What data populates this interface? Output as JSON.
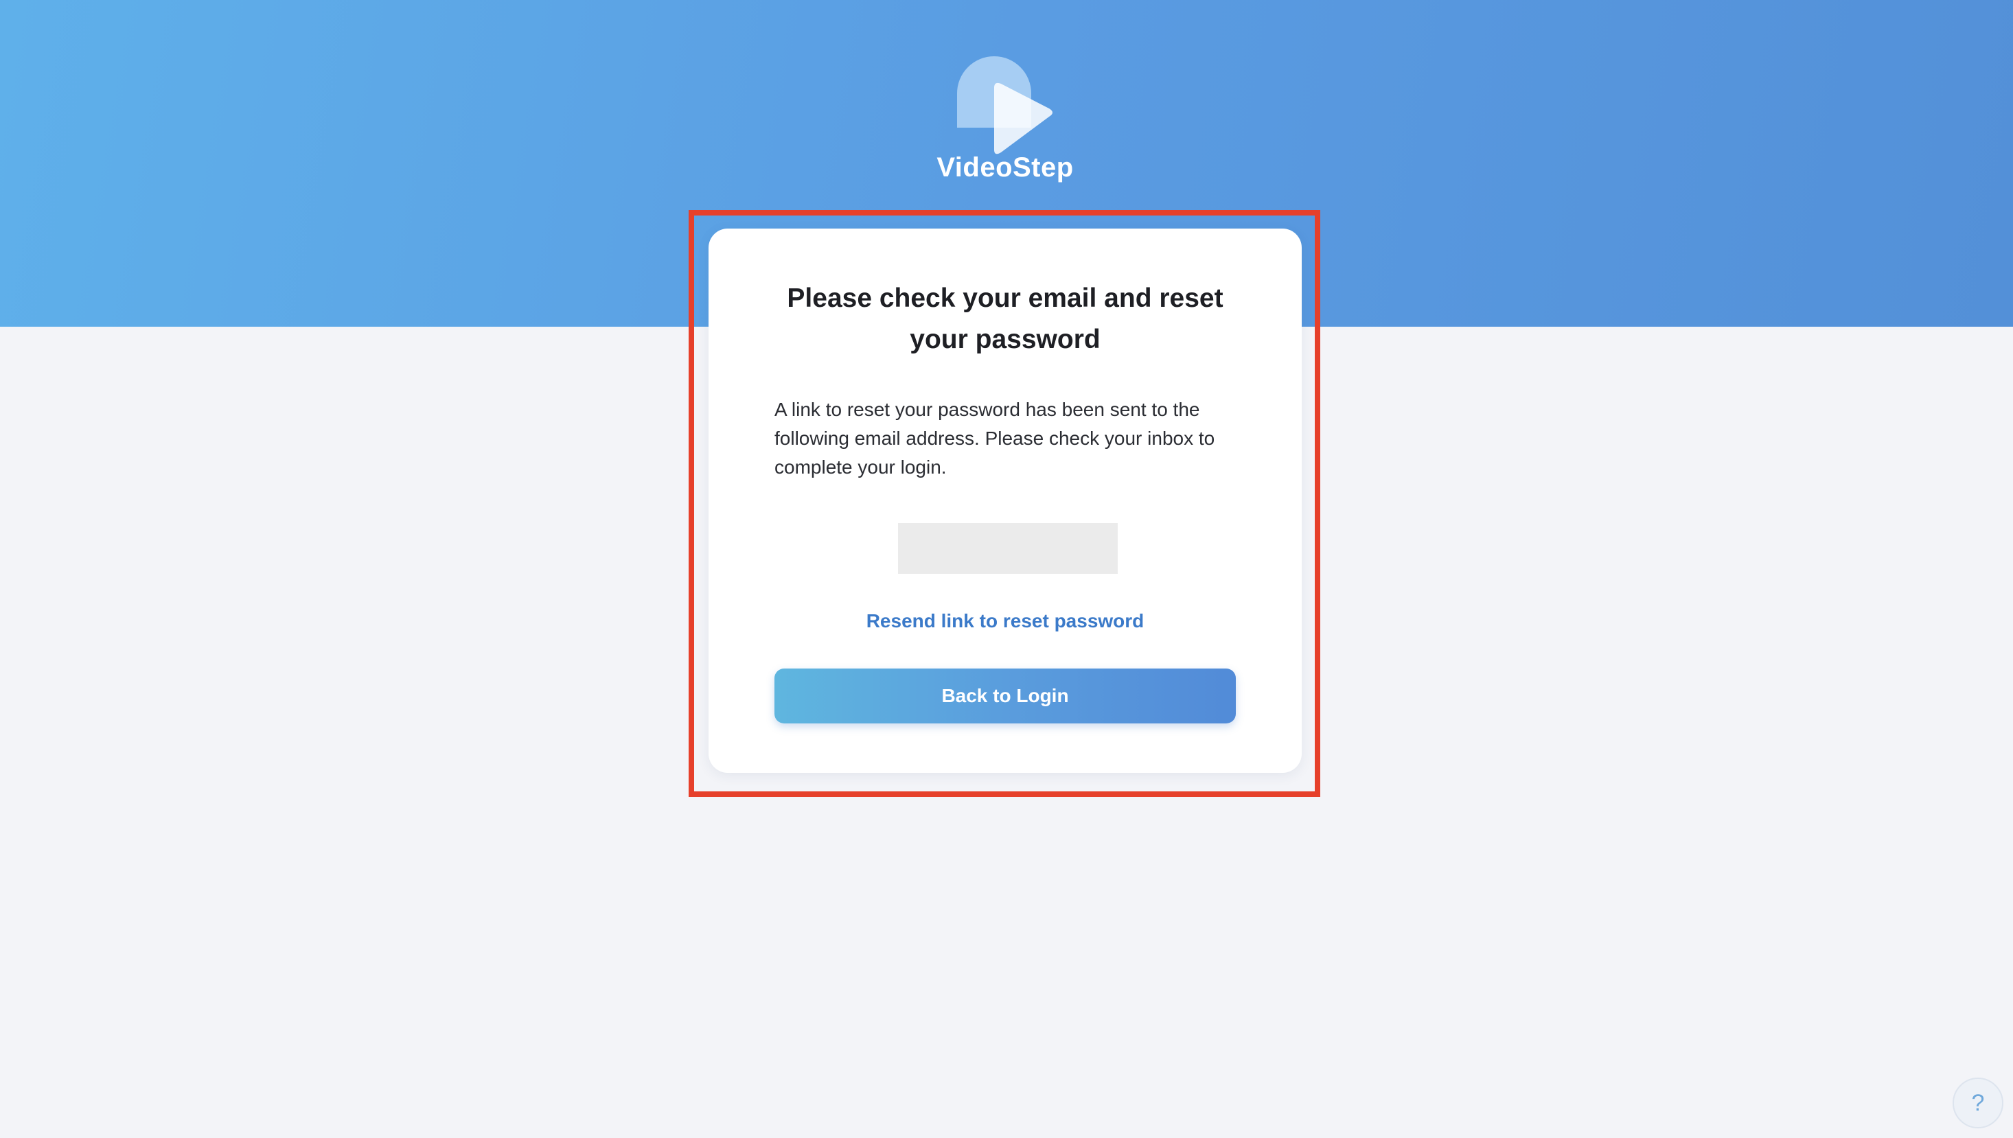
{
  "app": {
    "brand_name": "VideoStep",
    "logo_icon": "videostep-play-logo-icon"
  },
  "card": {
    "title": "Please check your email and reset your password",
    "body": "A link to reset your password has been sent to the following email address. Please check your inbox to complete your login.",
    "email_value": "",
    "resend_link_label": "Resend link to reset password",
    "back_button_label": "Back to Login"
  },
  "help": {
    "label": "?",
    "icon": "help-icon"
  },
  "colors": {
    "hero_gradient_start": "#5fb0ea",
    "hero_gradient_end": "#5390d8",
    "background": "#f3f4f8",
    "link": "#3b7ac9",
    "highlight_border": "#e6402b",
    "button_gradient_start": "#5fb6df",
    "button_gradient_end": "#528bd8"
  }
}
